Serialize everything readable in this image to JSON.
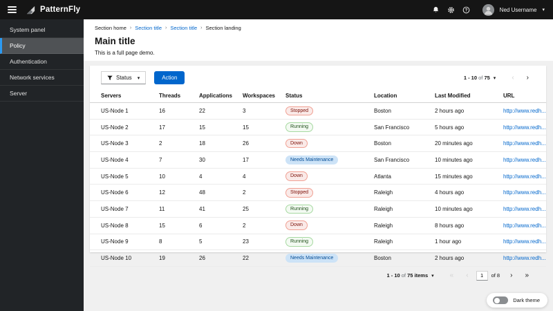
{
  "masthead": {
    "brand": "PatternFly",
    "user_name": "Ned Username"
  },
  "sidebar": {
    "items": [
      {
        "label": "System panel",
        "selected": false
      },
      {
        "label": "Policy",
        "selected": true
      },
      {
        "label": "Authentication",
        "selected": false
      },
      {
        "label": "Network services",
        "selected": false
      },
      {
        "label": "Server",
        "selected": false
      }
    ]
  },
  "breadcrumb": {
    "separator": "›",
    "items": [
      {
        "label": "Section home",
        "link": false
      },
      {
        "label": "Section title",
        "link": true
      },
      {
        "label": "Section title",
        "link": true
      },
      {
        "label": "Section landing",
        "link": false
      }
    ]
  },
  "page": {
    "title": "Main title",
    "subtitle": "This is a full page demo."
  },
  "toolbar": {
    "filter_label": "Status",
    "action_label": "Action"
  },
  "icons": {
    "caret_down": "▾",
    "prev": "‹",
    "next": "›",
    "first": "«",
    "last": "»"
  },
  "pagination_top": {
    "range": "1 - 10",
    "of_word": "of",
    "total": "75"
  },
  "pagination_bottom": {
    "range": "1 - 10",
    "of_word": "of",
    "total": "75 items",
    "page_value": "1",
    "of_pages": "of 8"
  },
  "table": {
    "columns": [
      "Servers",
      "Threads",
      "Applications",
      "Workspaces",
      "Status",
      "Location",
      "Last Modified",
      "URL"
    ],
    "rows": [
      {
        "server": "US-Node 1",
        "threads": "16",
        "applications": "22",
        "workspaces": "3",
        "status": "Stopped",
        "status_type": "red",
        "location": "Boston",
        "modified": "2 hours ago",
        "url": "http://www.redh..."
      },
      {
        "server": "US-Node 2",
        "threads": "17",
        "applications": "15",
        "workspaces": "15",
        "status": "Running",
        "status_type": "green",
        "location": "San Francisco",
        "modified": "5 hours ago",
        "url": "http://www.redh..."
      },
      {
        "server": "US-Node 3",
        "threads": "2",
        "applications": "18",
        "workspaces": "26",
        "status": "Down",
        "status_type": "red",
        "location": "Boston",
        "modified": "20 minutes ago",
        "url": "http://www.redh..."
      },
      {
        "server": "US-Node 4",
        "threads": "7",
        "applications": "30",
        "workspaces": "17",
        "status": "Needs Maintenance",
        "status_type": "blue",
        "location": "San Francisco",
        "modified": "10 minutes ago",
        "url": "http://www.redh..."
      },
      {
        "server": "US-Node 5",
        "threads": "10",
        "applications": "4",
        "workspaces": "4",
        "status": "Down",
        "status_type": "red",
        "location": "Atlanta",
        "modified": "15 minutes ago",
        "url": "http://www.redh..."
      },
      {
        "server": "US-Node 6",
        "threads": "12",
        "applications": "48",
        "workspaces": "2",
        "status": "Stopped",
        "status_type": "red",
        "location": "Raleigh",
        "modified": "4 hours ago",
        "url": "http://www.redh..."
      },
      {
        "server": "US-Node 7",
        "threads": "11",
        "applications": "41",
        "workspaces": "25",
        "status": "Running",
        "status_type": "green",
        "location": "Raleigh",
        "modified": "10 minutes ago",
        "url": "http://www.redh..."
      },
      {
        "server": "US-Node 8",
        "threads": "15",
        "applications": "6",
        "workspaces": "2",
        "status": "Down",
        "status_type": "red",
        "location": "Raleigh",
        "modified": "8 hours ago",
        "url": "http://www.redh..."
      },
      {
        "server": "US-Node 9",
        "threads": "8",
        "applications": "5",
        "workspaces": "23",
        "status": "Running",
        "status_type": "green",
        "location": "Raleigh",
        "modified": "1 hour ago",
        "url": "http://www.redh..."
      },
      {
        "server": "US-Node 10",
        "threads": "19",
        "applications": "26",
        "workspaces": "22",
        "status": "Needs Maintenance",
        "status_type": "blue",
        "location": "Boston",
        "modified": "2 hours ago",
        "url": "http://www.redh..."
      }
    ]
  },
  "theme_toggle": {
    "label": "Dark theme",
    "state": "off"
  },
  "colors": {
    "accent": "#0066cc",
    "masthead_bg": "#151515",
    "sidebar_bg": "#212427",
    "sidebar_selected_bg": "#4f5255",
    "nav_accent": "#2b9af3",
    "link": "#0066cc",
    "status_red_bg": "#faeae8",
    "status_red_text": "#7d1007",
    "status_green_bg": "#f3faf2",
    "status_green_text": "#1e4f18",
    "status_blue_bg": "#cde3f7",
    "status_blue_text": "#004b95"
  }
}
